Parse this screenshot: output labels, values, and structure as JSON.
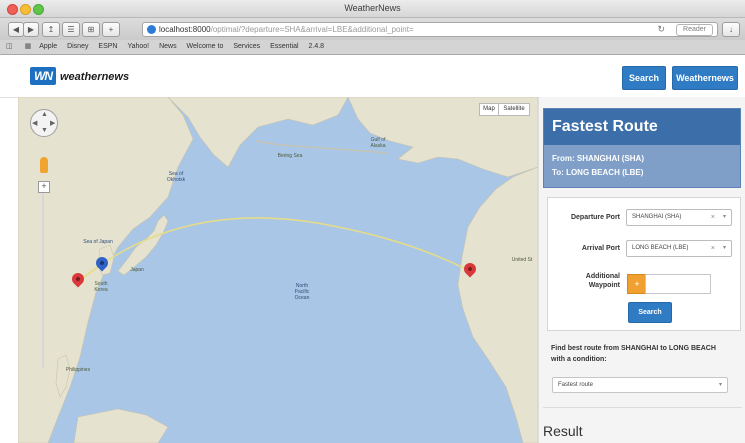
{
  "browser": {
    "window_title": "WeatherNews",
    "url_host": "localhost:8000",
    "url_rest": "/optimal/?departure=SHA&arrival=LBE&additional_point=",
    "reader_label": "Reader",
    "bookmarks": [
      "Apple",
      "Disney",
      "ESPN",
      "Yahoo!",
      "News",
      "Welcome to",
      "Services",
      "Essential",
      "2.4.8"
    ]
  },
  "header": {
    "logo_mark": "WN",
    "logo_text": "weathernews",
    "search_label": "Search",
    "weathernews_label": "Weathernews"
  },
  "map": {
    "controls": {
      "map_label": "Map",
      "satellite_label": "Satellite"
    },
    "labels": {
      "bering_sea": "Bering Sea",
      "sea_of_okhotsk": "Sea of\nOkhotsk",
      "south_korea": "South\nKorea",
      "japan": "Japan",
      "sea_of_japan": "Sea of Japan",
      "north_pacific": "North\nPacific\nOcean",
      "philippines": "Philippines",
      "united_states": "United St",
      "gulf_of_alaska": "Gulf of\nAlaska"
    },
    "colors": {
      "ocean": "#a9c6e6",
      "land": "#e6e2d0",
      "route": "#e5dc8a",
      "marker_departure": "#d9383a",
      "marker_waypoint": "#2f63c8",
      "marker_arrival": "#d9383a"
    }
  },
  "route": {
    "title": "Fastest Route",
    "from_line": "From: SHANGHAI (SHA)",
    "to_line": "To: LONG BEACH (LBE)"
  },
  "form": {
    "departure_label": "Departure Port",
    "departure_value": "SHANGHAI (SHA)",
    "arrival_label": "Arrival Port",
    "arrival_value": "LONG BEACH (LBE)",
    "waypoint_label": "Additional Waypoint",
    "add_label": "+",
    "search_label": "Search",
    "clear_glyph": "×",
    "caret_glyph": "▾"
  },
  "condition": {
    "text": "Find best route from SHANGHAI to LONG BEACH with a condition:",
    "select_value": "Fastest route"
  },
  "result_heading": "Result"
}
